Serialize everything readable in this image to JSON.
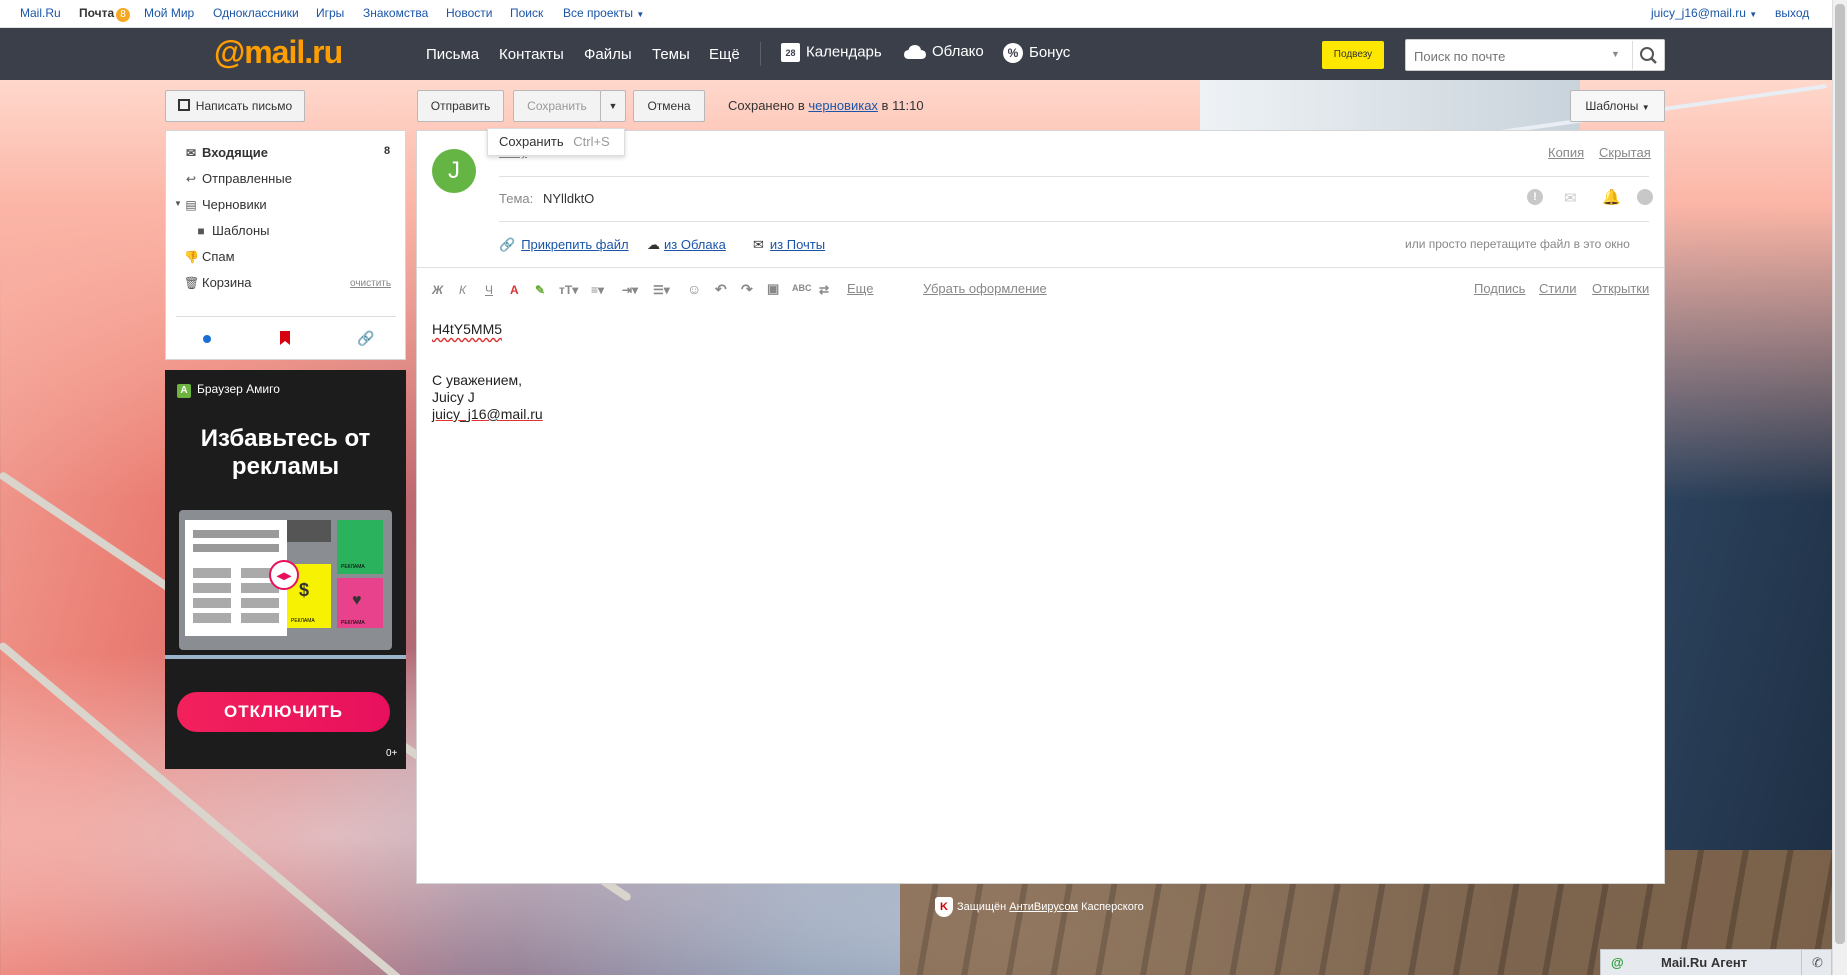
{
  "topbar": {
    "links": [
      "Mail.Ru",
      "Почта",
      "Мой Мир",
      "Одноклассники",
      "Игры",
      "Знакомства",
      "Новости",
      "Поиск",
      "Все проекты"
    ],
    "mail_badge": "8",
    "user": "juicy_j16@mail.ru",
    "logout": "выход"
  },
  "header": {
    "logo": "@mail.ru",
    "nav": [
      "Письма",
      "Контакты",
      "Файлы",
      "Темы",
      "Ещё"
    ],
    "calendar_day": "28",
    "calendar": "Календарь",
    "cloud": "Облако",
    "bonus": "Бонус",
    "subscribe": "Подвезу",
    "search_placeholder": "Поиск по почте"
  },
  "sidebar": {
    "compose": "Написать письмо",
    "folders": [
      {
        "label": "Входящие",
        "count": "8",
        "icon": "inbox-icon"
      },
      {
        "label": "Отправленные",
        "icon": "sent-icon"
      },
      {
        "label": "Черновики",
        "icon": "drafts-icon"
      },
      {
        "label": "Шаблоны",
        "icon": "folder-icon"
      },
      {
        "label": "Спам",
        "icon": "spam-icon"
      },
      {
        "label": "Корзина",
        "icon": "trash-icon"
      }
    ],
    "clear": "очистить"
  },
  "promo": {
    "brand": "Браузер Амиго",
    "headline": "Избавьтесь от рекламы",
    "ad_label": "РЕКЛАМА",
    "button": "ОТКЛЮЧИТЬ",
    "age": "0+"
  },
  "toolbar": {
    "send": "Отправить",
    "save": "Сохранить",
    "cancel": "Отмена",
    "saved_prefix": "Сохранено в",
    "saved_link": "черновиках",
    "saved_time": "в 11:10",
    "templates": "Шаблоны"
  },
  "tooltip": {
    "label": "Сохранить",
    "shortcut": "Ctrl+S"
  },
  "compose": {
    "avatar_letter": "J",
    "to_label": "Кому",
    "cc": "Копия",
    "bcc": "Скрытая",
    "subject_label": "Тема:",
    "subject_value": "NYlldktO",
    "attach": "Прикрепить файл",
    "from_cloud": "из Облака",
    "from_mail": "из Почты",
    "drag_hint": "или просто перетащите файл в это окно",
    "more": "Еще",
    "remove_format": "Убрать оформление",
    "signature": "Подпись",
    "styles": "Стили",
    "cards": "Открытки",
    "body_line1": "H4tY5MM5",
    "body_line2": "С уважением,",
    "body_line3": "Juicy J",
    "body_line4": "juicy_j16@mail.ru"
  },
  "footer": {
    "protected": "Защищён",
    "av_link": "АнтиВирусом",
    "vendor": "Касперского"
  },
  "agent": {
    "label": "Mail.Ru Агент"
  }
}
